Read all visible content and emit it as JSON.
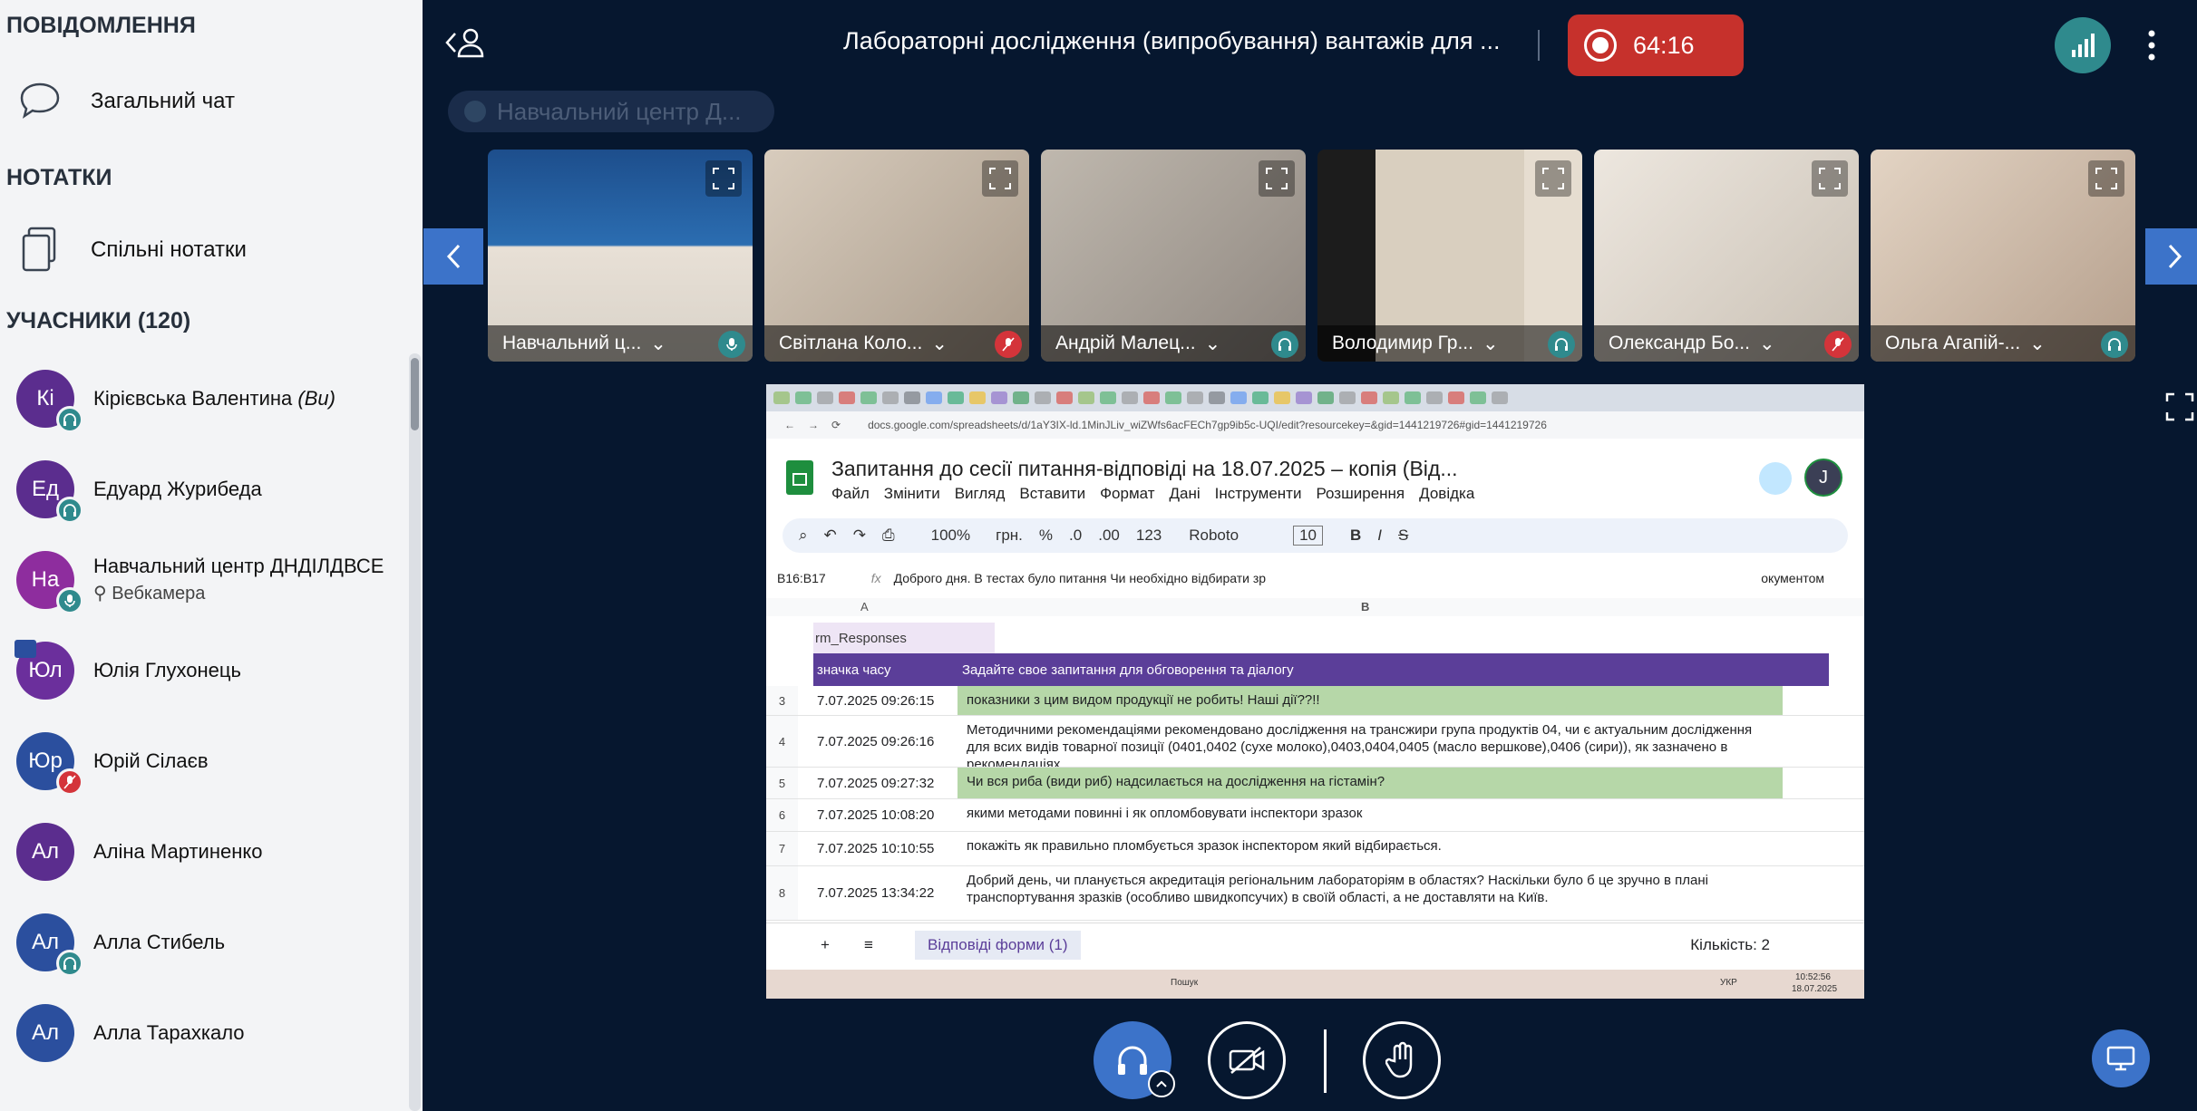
{
  "sidebar": {
    "messages_title": "ПОВІДОМЛЕННЯ",
    "chat_label": "Загальний чат",
    "notes_title": "НОТАТКИ",
    "notes_label": "Спільні нотатки",
    "participants_title": "УЧАСНИКИ",
    "participants_count": "(120)",
    "participants": [
      {
        "initials": "Кі",
        "name": "Кірієвська Валентина",
        "you": "(Ви)",
        "color": "#5b2d8e",
        "badge": "headphones",
        "badge_color": "#2f8a8d"
      },
      {
        "initials": "Ед",
        "name": "Едуард Журибеда",
        "color": "#5b2d8e",
        "badge": "headphones",
        "badge_color": "#2f8a8d"
      },
      {
        "initials": "На",
        "name": "Навчальний центр ДНДІЛДВСЕ",
        "sub": "Вебкамера",
        "color": "#8e2d9e",
        "badge": "mic",
        "badge_color": "#2f8a8d"
      },
      {
        "initials": "Юл",
        "name": "Юлія Глухонець",
        "color": "#6b2f9c",
        "badge": "none"
      },
      {
        "initials": "Юр",
        "name": "Юрій Сілаєв",
        "color": "#2b4f9e",
        "badge": "mic-off",
        "badge_color": "#d4343a"
      },
      {
        "initials": "Ал",
        "name": "Аліна Мартиненко",
        "color": "#5b2d8e",
        "badge": "none"
      },
      {
        "initials": "Ал",
        "name": "Алла Стибель",
        "color": "#2b4f9e",
        "badge": "headphones",
        "badge_color": "#2f8a8d"
      },
      {
        "initials": "Ал",
        "name": "Алла Тарахкало",
        "color": "#2b4f9e",
        "badge": "none"
      }
    ]
  },
  "header": {
    "title": "Лабораторні дослідження (випробування) вантажів для ...",
    "timer": "64:16",
    "presenter": "Навчальний центр Д..."
  },
  "tiles": [
    {
      "name": "Навчальний ц...",
      "mic": "on"
    },
    {
      "name": "Світлана Коло...",
      "mic": "off"
    },
    {
      "name": "Андрій Малец...",
      "mic": "headphones"
    },
    {
      "name": "Володимир Гр...",
      "mic": "headphones"
    },
    {
      "name": "Олександр Бо...",
      "mic": "off"
    },
    {
      "name": "Ольга Агапій-...",
      "mic": "headphones"
    }
  ],
  "share": {
    "url": "docs.google.com/spreadsheets/d/1aY3IX-ld.1MinJLiv_wiZWfs6acFECh7gp9ib5c-UQI/edit?resourcekey=&gid=1441219726#gid=1441219726",
    "doc_title": "Запитання до сесії питання-відповіді на 18.07.2025  – копія (Від...",
    "menu": [
      "Файл",
      "Змінити",
      "Вигляд",
      "Вставити",
      "Формат",
      "Дані",
      "Інструменти",
      "Розширення",
      "Довідка"
    ],
    "toolbar": {
      "zoom": "100%",
      "currency": "грн.",
      "percent": "%",
      "dec1": ".0",
      "dec2": ".00",
      "num": "123",
      "font": "Roboto",
      "size": "10"
    },
    "cell_ref": "B16:B17",
    "formula": "Доброго дня. В тестах було питання Чи необхідно відбирати зр",
    "formula_tail": "окументом",
    "col_a": "A",
    "col_b": "B",
    "table_name": "rm_Responses",
    "header_a": "значка часу",
    "header_b": "Задайте свое запитання для обговорення та діалогу",
    "rows": [
      {
        "n": "3",
        "ts": "7.07.2025 09:26:15",
        "q": "показники з цим видом продукції не робить! Наші дії??!!",
        "hl": true
      },
      {
        "n": "4",
        "ts": "7.07.2025 09:26:16",
        "q": "Методичними рекомендаціями рекомендовано дослідження на трансжири група продуктів 04, чи є актуальним дослідження для всих видів товарної позиції (0401,0402 (сухе молоко),0403,0404,0405 (масло вершкове),0406 (сири)), як зазначено в рекомендаціях",
        "hl": false
      },
      {
        "n": "5",
        "ts": "7.07.2025 09:27:32",
        "q": "Чи вся риба (види риб) надсилається на дослідження на гістамін?",
        "hl": true
      },
      {
        "n": "6",
        "ts": "7.07.2025 10:08:20",
        "q": "якими методами повинні і як опломбовувати інспектори зразок",
        "hl": false
      },
      {
        "n": "7",
        "ts": "7.07.2025 10:10:55",
        "q": "покажіть як правильно  пломбується зразок інспектором який відбирається.",
        "hl": false
      },
      {
        "n": "8",
        "ts": "7.07.2025 13:34:22",
        "q": "Добрий день, чи планується акредитація регіональним лабораторіям  в областях? Наскільки було б це зручно в плані транспортування зразків                        (особливо швидкопсучих) в своїй області, а не доставляти на Київ.",
        "hl": false
      }
    ],
    "sheet_tab": "Відповіді форми (1)",
    "count": "Кількість: 2",
    "taskbar_search": "Пошук",
    "taskbar_lang": "УКР",
    "taskbar_time": "10:52:56",
    "taskbar_date": "18.07.2025"
  },
  "colors": {
    "accent": "#3c73c9",
    "record": "#c6312c",
    "sheet_header": "#5b3e99",
    "highlight": "#b6d7a8"
  }
}
